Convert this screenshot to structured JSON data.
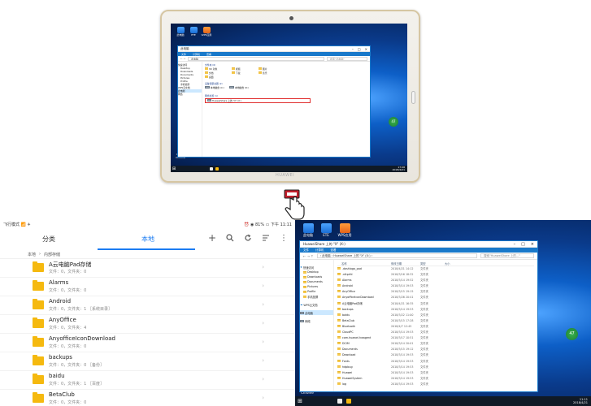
{
  "tablet": {
    "brand": "HUAWEI",
    "desktop_icons": [
      {
        "label": "此电脑"
      },
      {
        "label": "ETE"
      },
      {
        "label": "WPS应用"
      }
    ],
    "bottom_icons": [
      {
        "label": "Google Chrome"
      },
      {
        "label": "WPS文字"
      }
    ],
    "ball_text": "47",
    "explorer": {
      "title": "此电脑",
      "ribbon": [
        "文件",
        "计算机",
        "查看"
      ],
      "address": "此电脑",
      "search": "搜索\"此电脑\"",
      "folders_header": "文件夹 (6)",
      "folders": [
        "3D 对象",
        "视频",
        "图片",
        "文档",
        "下载",
        "音乐",
        "桌面"
      ],
      "drives_header": "设备和驱动器 (2)",
      "drives": [
        "本地磁盘 (C:)",
        "本地磁盘 (D:)"
      ],
      "network_header": "网络位置 (1)",
      "network": "HuaweiShare 上的 \"X\" (X:)",
      "nav": [
        "快速访问",
        "Desktop",
        "Downloads",
        "Documents",
        "Pictures",
        "Profile",
        "手机投屏",
        "WPS云文档",
        "此电脑",
        "网络"
      ]
    },
    "clock_time": "17:08",
    "clock_date": "2018/4/21"
  },
  "file_manager": {
    "status_left": "飞行模式 📶 ✈",
    "status_right": "⏰ ◉ 81% ▭ 下午 11:11",
    "tab_categories": "分类",
    "tab_local": "本地",
    "crumb_root": "本地",
    "crumb_sep": "›",
    "crumb_current": "内部存储",
    "items": [
      {
        "name": "A云电脑Pad存储",
        "meta": "文件：0，文件夹：0"
      },
      {
        "name": "Alarms",
        "meta": "文件：0，文件夹：0"
      },
      {
        "name": "Android",
        "meta": "文件：0，文件夹：1   ［系统目录］"
      },
      {
        "name": "AnyOffice",
        "meta": "文件：0，文件夹：4"
      },
      {
        "name": "AnyofficeIconDownload",
        "meta": "文件：0，文件夹：0"
      },
      {
        "name": "backups",
        "meta": "文件：0，文件夹：0   ［备份］"
      },
      {
        "name": "baidu",
        "meta": "文件：0，文件夹：1   ［百度］"
      },
      {
        "name": "BetaClub",
        "meta": "文件：0，文件夹：0"
      }
    ]
  },
  "desktop": {
    "icons": [
      {
        "label": "此电脑"
      },
      {
        "label": "ETE"
      },
      {
        "label": "WPS应用"
      }
    ],
    "bottom_icons": [
      {
        "label": "Google Chrome"
      },
      {
        "label": "WPS文字"
      }
    ],
    "ball_text": "47",
    "explorer": {
      "title": "HuaweiShare 上的 \"X\" (X:)",
      "ribbon": [
        "文件",
        "计算机",
        "查看"
      ],
      "address": "› 此电脑 › HuaweiShare 上的 \"X\" (X:) ›",
      "search": "搜索\"HuaweiShare 上的...\"",
      "columns": [
        "名称",
        "修改日期",
        "类型",
        "大小"
      ],
      "nav": [
        "快速访问",
        "Desktop",
        "Downloads",
        "Documents",
        "Pictures",
        "Profile",
        "手机投屏",
        "WPS云文档",
        "此电脑",
        "网络"
      ],
      "files": [
        {
          "name": ".dashlogo_pad",
          "date": "2018/4/21 14:12",
          "type": "文件夹"
        },
        {
          "name": ".nttprfd",
          "date": "2018/3/16 18:32",
          "type": "文件夹"
        },
        {
          "name": "Alarms",
          "date": "2018/3/14 19:52",
          "type": "文件夹"
        },
        {
          "name": "Android",
          "date": "2018/3/14 19:53",
          "type": "文件夹"
        },
        {
          "name": "AnyOffice",
          "date": "2018/3/15 19:15",
          "type": "文件夹"
        },
        {
          "name": "AnyofficeIconDownload",
          "date": "2018/3/26 20:41",
          "type": "文件夹"
        },
        {
          "name": "A云电脑Pad存储",
          "date": "2018/4/21 16:35",
          "type": "文件夹"
        },
        {
          "name": "backups",
          "date": "2018/3/14 19:53",
          "type": "文件夹"
        },
        {
          "name": "baidu",
          "date": "2018/3/22 11:00",
          "type": "文件夹"
        },
        {
          "name": "BetaClub",
          "date": "2018/3/15 17:28",
          "type": "文件夹"
        },
        {
          "name": "Bluetooth",
          "date": "2018/4/7 12:45",
          "type": "文件夹"
        },
        {
          "name": "CloudPC",
          "date": "2018/3/14 19:53",
          "type": "文件夹"
        },
        {
          "name": "com.huawei.hwagent",
          "date": "2018/3/17 10:51",
          "type": "文件夹"
        },
        {
          "name": "DCIM",
          "date": "2018/3/14 20:01",
          "type": "文件夹"
        },
        {
          "name": "Documents",
          "date": "2018/3/15 19:12",
          "type": "文件夹"
        },
        {
          "name": "Download",
          "date": "2018/3/14 19:53",
          "type": "文件夹"
        },
        {
          "name": "Fonts",
          "date": "2018/3/14 19:53",
          "type": "文件夹"
        },
        {
          "name": "hdpbug",
          "date": "2018/3/14 19:53",
          "type": "文件夹"
        },
        {
          "name": "Huawei",
          "date": "2018/3/14 19:53",
          "type": "文件夹"
        },
        {
          "name": "HuaweiSystem",
          "date": "2018/3/14 19:53",
          "type": "文件夹"
        },
        {
          "name": "log",
          "date": "2018/3/14 19:53",
          "type": "文件夹"
        }
      ]
    },
    "clock_time": "11:11",
    "clock_date": "2018/4/21"
  },
  "colors": {
    "accent": "#1b7cf2",
    "folder": "#f5b90f",
    "win_blue": "#1979ca",
    "taskbar": "#101a26"
  }
}
